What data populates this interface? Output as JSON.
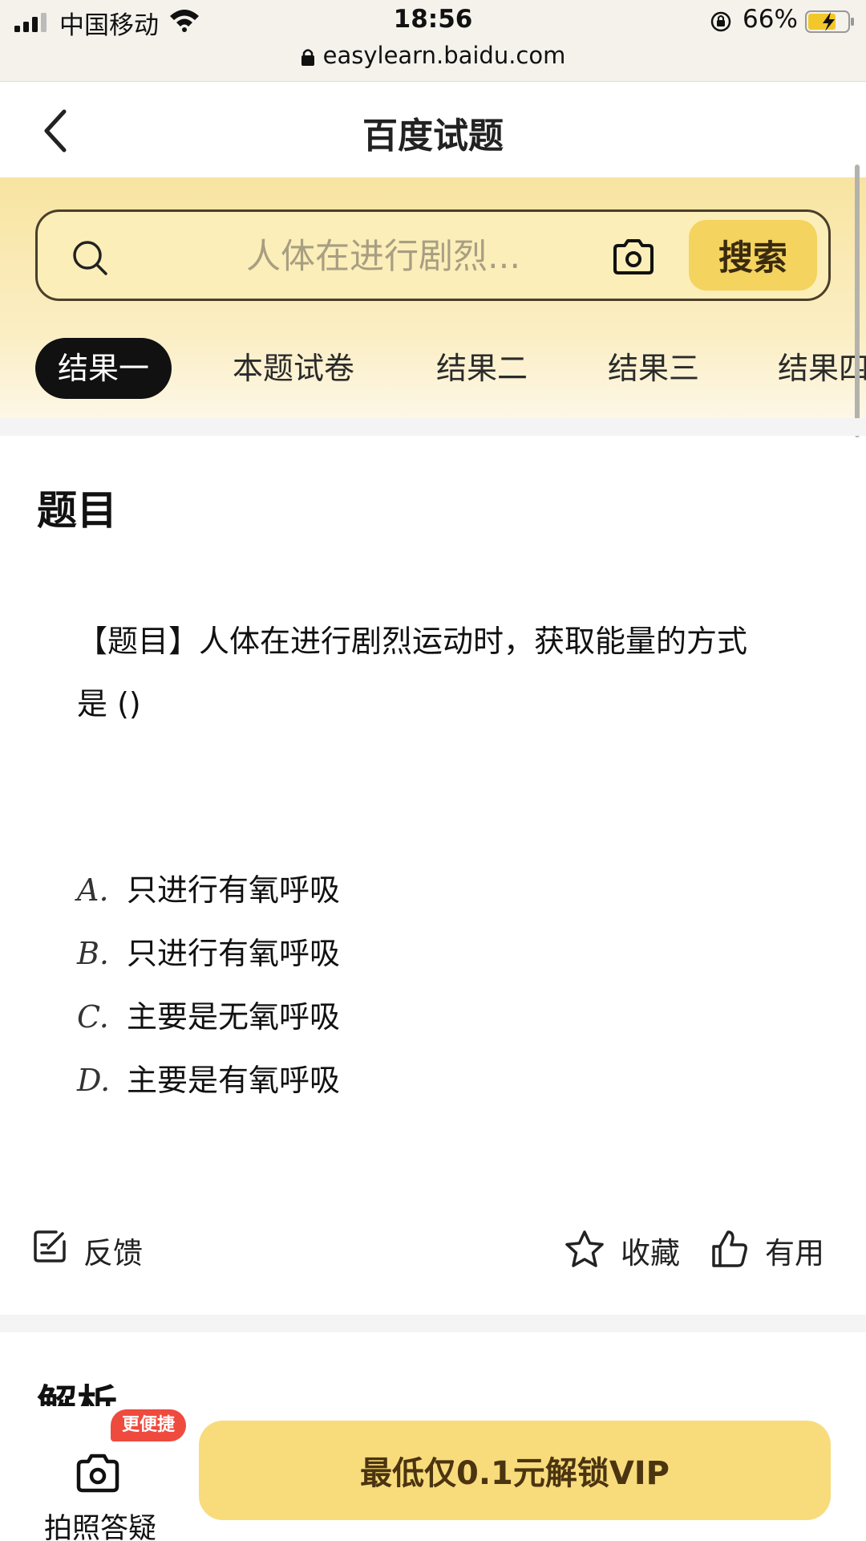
{
  "status_bar": {
    "carrier": "中国移动",
    "time": "18:56",
    "battery": "66%",
    "url": "easylearn.baidu.com"
  },
  "nav": {
    "title": "百度试题"
  },
  "search": {
    "placeholder": "人体在进行剧烈...",
    "button": "搜索"
  },
  "tabs": [
    "结果一",
    "本题试卷",
    "结果二",
    "结果三",
    "结果四"
  ],
  "question_section": {
    "title": "题目",
    "text_line1": "【题目】人体在进行剧烈运动时，获取能量的方式",
    "text_line2": "是 ()",
    "options": [
      {
        "letter": "A.",
        "text": "只进行有氧呼吸"
      },
      {
        "letter": "B.",
        "text": "只进行有氧呼吸"
      },
      {
        "letter": "C.",
        "text": "主要是无氧呼吸"
      },
      {
        "letter": "D.",
        "text": "主要是有氧呼吸"
      }
    ]
  },
  "actions": {
    "feedback": "反馈",
    "collect": "收藏",
    "useful": "有用"
  },
  "analysis": {
    "title": "解析"
  },
  "bottom": {
    "photo_label": "拍照答疑",
    "badge": "更便捷",
    "vip": "最低仅0.1元解锁VIP"
  },
  "colors": {
    "accent_yellow": "#f4d35e",
    "header_yellow": "#f8e4a1",
    "badge_red": "#ef4a3e"
  },
  "icons": [
    "signal-icon",
    "wifi-icon",
    "orientation-lock-icon",
    "battery-charging-icon",
    "padlock-icon",
    "back-chevron-icon",
    "search-icon",
    "camera-icon",
    "feedback-icon",
    "star-icon",
    "thumbs-up-icon"
  ]
}
